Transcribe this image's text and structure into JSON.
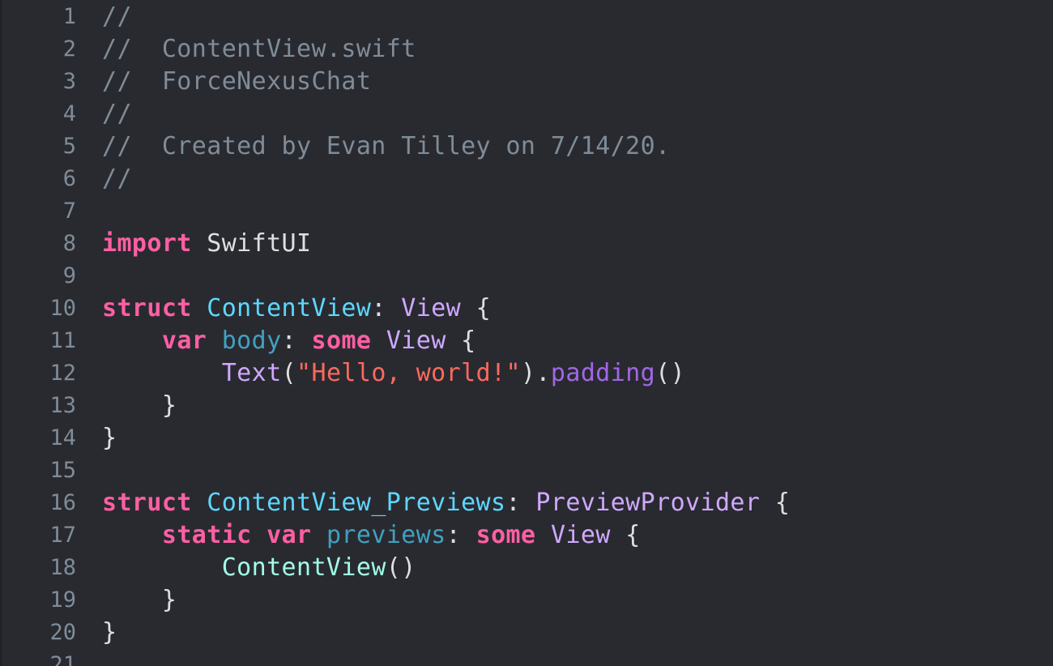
{
  "editor": {
    "lines": [
      {
        "num": "1",
        "tokens": [
          {
            "t": "//",
            "c": "cmt"
          }
        ]
      },
      {
        "num": "2",
        "tokens": [
          {
            "t": "//  ContentView.swift",
            "c": "cmt"
          }
        ]
      },
      {
        "num": "3",
        "tokens": [
          {
            "t": "//  ForceNexusChat",
            "c": "cmt"
          }
        ]
      },
      {
        "num": "4",
        "tokens": [
          {
            "t": "//",
            "c": "cmt"
          }
        ]
      },
      {
        "num": "5",
        "tokens": [
          {
            "t": "//  Created by Evan Tilley on 7/14/20.",
            "c": "cmt"
          }
        ]
      },
      {
        "num": "6",
        "tokens": [
          {
            "t": "//",
            "c": "cmt"
          }
        ]
      },
      {
        "num": "7",
        "tokens": []
      },
      {
        "num": "8",
        "tokens": [
          {
            "t": "import",
            "c": "kw"
          },
          {
            "t": " SwiftUI",
            "c": "plain"
          }
        ]
      },
      {
        "num": "9",
        "tokens": []
      },
      {
        "num": "10",
        "tokens": [
          {
            "t": "struct",
            "c": "kw"
          },
          {
            "t": " ",
            "c": "plain"
          },
          {
            "t": "ContentView",
            "c": "typedecl"
          },
          {
            "t": ": ",
            "c": "plain"
          },
          {
            "t": "View",
            "c": "type"
          },
          {
            "t": " {",
            "c": "plain"
          }
        ]
      },
      {
        "num": "11",
        "tokens": [
          {
            "t": "    ",
            "c": "plain"
          },
          {
            "t": "var",
            "c": "kw"
          },
          {
            "t": " ",
            "c": "plain"
          },
          {
            "t": "body",
            "c": "prop"
          },
          {
            "t": ": ",
            "c": "plain"
          },
          {
            "t": "some",
            "c": "kw"
          },
          {
            "t": " ",
            "c": "plain"
          },
          {
            "t": "View",
            "c": "type"
          },
          {
            "t": " {",
            "c": "plain"
          }
        ]
      },
      {
        "num": "12",
        "tokens": [
          {
            "t": "        ",
            "c": "plain"
          },
          {
            "t": "Text",
            "c": "type"
          },
          {
            "t": "(",
            "c": "plain"
          },
          {
            "t": "\"Hello, world!\"",
            "c": "str"
          },
          {
            "t": ").",
            "c": "plain"
          },
          {
            "t": "padding",
            "c": "method"
          },
          {
            "t": "()",
            "c": "plain"
          }
        ]
      },
      {
        "num": "13",
        "tokens": [
          {
            "t": "    }",
            "c": "plain"
          }
        ]
      },
      {
        "num": "14",
        "tokens": [
          {
            "t": "}",
            "c": "plain"
          }
        ]
      },
      {
        "num": "15",
        "tokens": []
      },
      {
        "num": "16",
        "tokens": [
          {
            "t": "struct",
            "c": "kw"
          },
          {
            "t": " ",
            "c": "plain"
          },
          {
            "t": "ContentView_Previews",
            "c": "typedecl"
          },
          {
            "t": ": ",
            "c": "plain"
          },
          {
            "t": "PreviewProvider",
            "c": "type"
          },
          {
            "t": " {",
            "c": "plain"
          }
        ]
      },
      {
        "num": "17",
        "tokens": [
          {
            "t": "    ",
            "c": "plain"
          },
          {
            "t": "static",
            "c": "kw"
          },
          {
            "t": " ",
            "c": "plain"
          },
          {
            "t": "var",
            "c": "kw"
          },
          {
            "t": " ",
            "c": "plain"
          },
          {
            "t": "previews",
            "c": "prop"
          },
          {
            "t": ": ",
            "c": "plain"
          },
          {
            "t": "some",
            "c": "kw"
          },
          {
            "t": " ",
            "c": "plain"
          },
          {
            "t": "View",
            "c": "type"
          },
          {
            "t": " {",
            "c": "plain"
          }
        ]
      },
      {
        "num": "18",
        "tokens": [
          {
            "t": "        ",
            "c": "plain"
          },
          {
            "t": "ContentView",
            "c": "ref"
          },
          {
            "t": "()",
            "c": "plain"
          }
        ]
      },
      {
        "num": "19",
        "tokens": [
          {
            "t": "    }",
            "c": "plain"
          }
        ]
      },
      {
        "num": "20",
        "tokens": [
          {
            "t": "}",
            "c": "plain"
          }
        ]
      },
      {
        "num": "21",
        "tokens": []
      }
    ]
  },
  "colors": {
    "background": "#292a30",
    "comment": "#7f8c98",
    "keyword": "#fc5fa3",
    "plain": "#dfdfe0",
    "type_declaration": "#5dd8ff",
    "type": "#d0a8ff",
    "property": "#41a1c0",
    "string": "#fc6a5d",
    "method": "#a167e6",
    "reference": "#a2fbe8"
  }
}
